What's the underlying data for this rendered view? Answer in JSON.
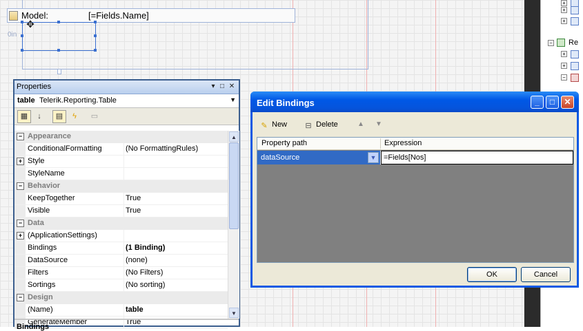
{
  "designer": {
    "model_label": "Model:",
    "model_value": "[=Fields.Name]",
    "ruler_label": "0in"
  },
  "explorer": {
    "partial_label": "Re"
  },
  "properties": {
    "title": "Properties",
    "object_type_bold": "table",
    "object_type_rest": "Telerik.Reporting.Table",
    "rows": [
      {
        "kind": "cat",
        "name": "Appearance"
      },
      {
        "kind": "prop",
        "name": "ConditionalFormatting",
        "value": "(No FormattingRules)"
      },
      {
        "kind": "prop",
        "name": "Style",
        "value": "",
        "expandable": true
      },
      {
        "kind": "prop",
        "name": "StyleName",
        "value": ""
      },
      {
        "kind": "cat",
        "name": "Behavior"
      },
      {
        "kind": "prop",
        "name": "KeepTogether",
        "value": "True"
      },
      {
        "kind": "prop",
        "name": "Visible",
        "value": "True"
      },
      {
        "kind": "cat",
        "name": "Data"
      },
      {
        "kind": "prop",
        "name": "(ApplicationSettings)",
        "value": "",
        "expandable": true
      },
      {
        "kind": "prop",
        "name": "Bindings",
        "value": "(1 Binding)",
        "bold": true
      },
      {
        "kind": "prop",
        "name": "DataSource",
        "value": "(none)"
      },
      {
        "kind": "prop",
        "name": "Filters",
        "value": "(No Filters)"
      },
      {
        "kind": "prop",
        "name": "Sortings",
        "value": "(No sorting)"
      },
      {
        "kind": "cat",
        "name": "Design"
      },
      {
        "kind": "prop",
        "name": "(Name)",
        "value": "table",
        "bold": true
      },
      {
        "kind": "prop",
        "name": "GenerateMember",
        "value": "True"
      }
    ],
    "help_title": "Bindings"
  },
  "dialog": {
    "title": "Edit Bindings",
    "new_label": "New",
    "delete_label": "Delete",
    "col_property_path": "Property path",
    "col_expression": "Expression",
    "row_property_path": "dataSource",
    "row_expression": "=Fields[Nos]",
    "ok_label": "OK",
    "cancel_label": "Cancel"
  },
  "colors": {
    "xp_title_blue": "#0058e6",
    "selection_blue": "#316ac5",
    "dialog_face": "#ece9d8",
    "empty_grid": "#808080"
  }
}
